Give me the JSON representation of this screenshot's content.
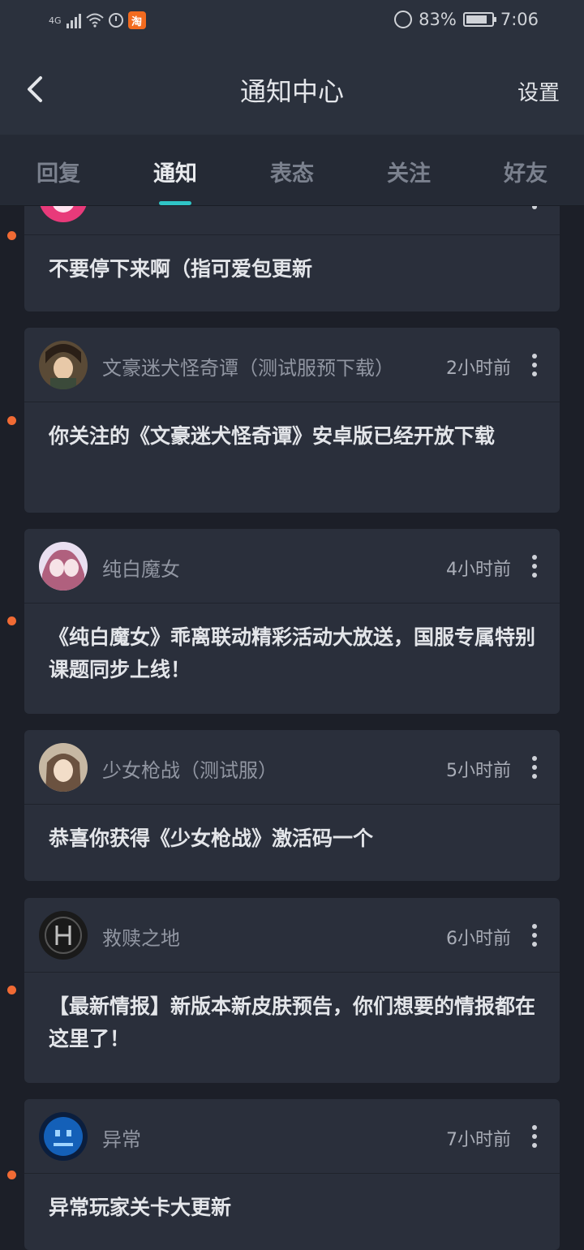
{
  "status_bar": {
    "network": "4G",
    "battery": "83%",
    "battery_level": 0.83,
    "time": "7:06",
    "app_icon_glyph": "淘"
  },
  "header": {
    "title": "通知中心",
    "settings_label": "设置",
    "back_icon": "chevron-left-icon"
  },
  "tabs": [
    {
      "label": "回复"
    },
    {
      "label": "通知"
    },
    {
      "label": "表态"
    },
    {
      "label": "关注"
    },
    {
      "label": "好友"
    }
  ],
  "active_tab": "通知",
  "colors": {
    "accent": "#2fc4c6",
    "unread_dot": "#f06a34",
    "background": "#1c1f28",
    "card": "#2a2f3b"
  },
  "notifications": [
    {
      "source": "",
      "time": "",
      "body": "不要停下来啊（指可爱包更新",
      "unread": true
    },
    {
      "source": "文豪迷犬怪奇谭（测试服预下载）",
      "time": "2小时前",
      "body": "你关注的《文豪迷犬怪奇谭》安卓版已经开放下载",
      "unread": true
    },
    {
      "source": "纯白魔女",
      "time": "4小时前",
      "body": "《纯白魔女》乖离联动精彩活动大放送，国服专属特别课题同步上线！",
      "unread": true
    },
    {
      "source": "少女枪战（测试服）",
      "time": "5小时前",
      "body": "恭喜你获得《少女枪战》激活码一个",
      "unread": false
    },
    {
      "source": "救赎之地",
      "time": "6小时前",
      "body": "【最新情报】新版本新皮肤预告，你们想要的情报都在这里了！",
      "unread": true
    },
    {
      "source": "异常",
      "time": "7小时前",
      "body": "异常玩家关卡大更新",
      "unread": true
    }
  ]
}
